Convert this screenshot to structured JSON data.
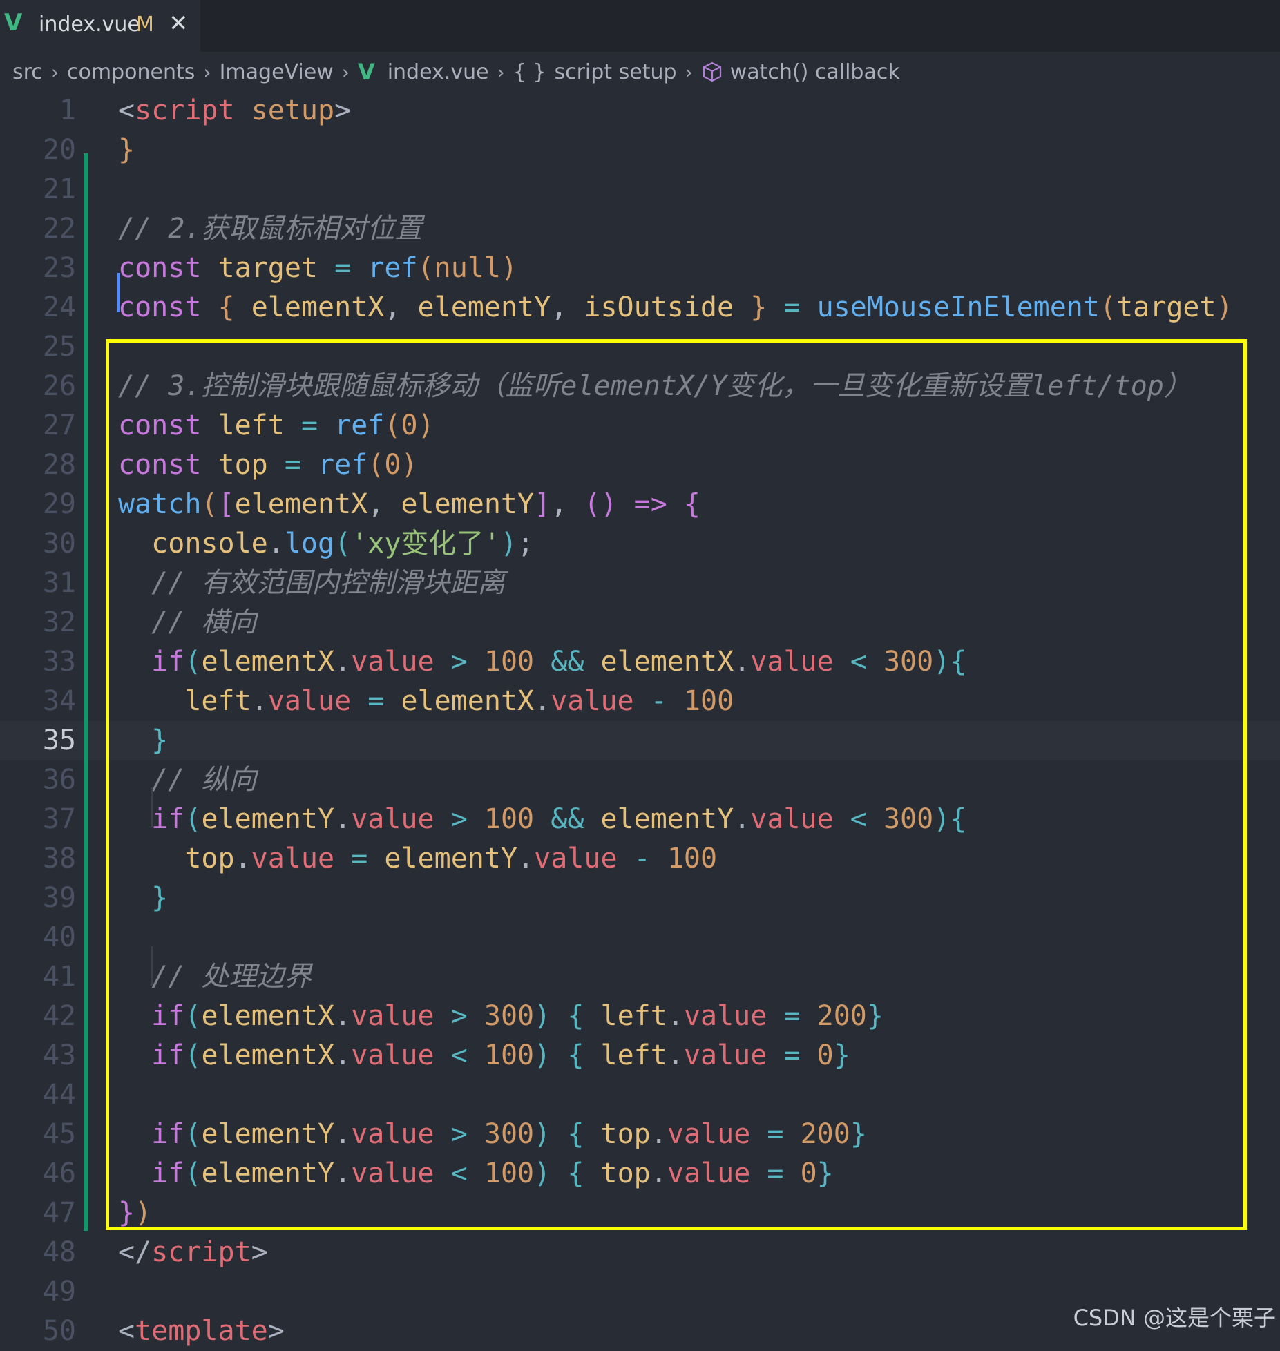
{
  "tab": {
    "filename": "index.vue",
    "status": "M",
    "close_glyph": "✕",
    "vue_icon": "V"
  },
  "breadcrumb": {
    "items": [
      "src",
      "components",
      "ImageView",
      "index.vue",
      "script setup",
      "watch() callback"
    ],
    "separator": "›",
    "braces_glyph": "{ }"
  },
  "editor": {
    "current_line": "35",
    "lines": [
      {
        "n": "1",
        "tokens": [
          [
            "tagp",
            "<"
          ],
          [
            "tag",
            "script"
          ],
          [
            "punc",
            " "
          ],
          [
            "attr",
            "setup"
          ],
          [
            "tagp",
            ">"
          ]
        ]
      },
      {
        "n": "20",
        "tokens": [
          [
            "b1",
            "}"
          ]
        ]
      },
      {
        "n": "21",
        "tokens": []
      },
      {
        "n": "22",
        "tokens": [
          [
            "com",
            "// 2.获取鼠标相对位置"
          ]
        ]
      },
      {
        "n": "23",
        "tokens": [
          [
            "kw",
            "const"
          ],
          [
            "punc",
            " "
          ],
          [
            "var",
            "target"
          ],
          [
            "punc",
            " "
          ],
          [
            "op",
            "="
          ],
          [
            "punc",
            " "
          ],
          [
            "fn",
            "ref"
          ],
          [
            "b1",
            "("
          ],
          [
            "num",
            "null"
          ],
          [
            "b1",
            ")"
          ]
        ]
      },
      {
        "n": "24",
        "tokens": [
          [
            "kw",
            "const"
          ],
          [
            "punc",
            " "
          ],
          [
            "b1",
            "{"
          ],
          [
            "punc",
            " "
          ],
          [
            "var",
            "elementX"
          ],
          [
            "punc",
            ", "
          ],
          [
            "var",
            "elementY"
          ],
          [
            "punc",
            ", "
          ],
          [
            "var",
            "isOutside"
          ],
          [
            "punc",
            " "
          ],
          [
            "b1",
            "}"
          ],
          [
            "punc",
            " "
          ],
          [
            "op",
            "="
          ],
          [
            "punc",
            " "
          ],
          [
            "fn",
            "useMouseInElement"
          ],
          [
            "b1",
            "("
          ],
          [
            "var",
            "target"
          ],
          [
            "b1",
            ")"
          ]
        ]
      },
      {
        "n": "25",
        "tokens": []
      },
      {
        "n": "26",
        "tokens": [
          [
            "com",
            "// 3.控制滑块跟随鼠标移动（监听elementX/Y变化，一旦变化重新设置left/top）"
          ]
        ]
      },
      {
        "n": "27",
        "tokens": [
          [
            "kw",
            "const"
          ],
          [
            "punc",
            " "
          ],
          [
            "var",
            "left"
          ],
          [
            "punc",
            " "
          ],
          [
            "op",
            "="
          ],
          [
            "punc",
            " "
          ],
          [
            "fn",
            "ref"
          ],
          [
            "b1",
            "("
          ],
          [
            "num",
            "0"
          ],
          [
            "b1",
            ")"
          ]
        ]
      },
      {
        "n": "28",
        "tokens": [
          [
            "kw",
            "const"
          ],
          [
            "punc",
            " "
          ],
          [
            "var",
            "top"
          ],
          [
            "punc",
            " "
          ],
          [
            "op",
            "="
          ],
          [
            "punc",
            " "
          ],
          [
            "fn",
            "ref"
          ],
          [
            "b1",
            "("
          ],
          [
            "num",
            "0"
          ],
          [
            "b1",
            ")"
          ]
        ]
      },
      {
        "n": "29",
        "tokens": [
          [
            "fn",
            "watch"
          ],
          [
            "b1",
            "("
          ],
          [
            "b2",
            "["
          ],
          [
            "var",
            "elementX"
          ],
          [
            "punc",
            ", "
          ],
          [
            "var",
            "elementY"
          ],
          [
            "b2",
            "]"
          ],
          [
            "punc",
            ", "
          ],
          [
            "b2",
            "()"
          ],
          [
            "punc",
            " "
          ],
          [
            "kw",
            "=>"
          ],
          [
            "punc",
            " "
          ],
          [
            "b2",
            "{"
          ]
        ]
      },
      {
        "n": "30",
        "tokens": [
          [
            "punc",
            "  "
          ],
          [
            "var",
            "console"
          ],
          [
            "punc",
            "."
          ],
          [
            "fn",
            "log"
          ],
          [
            "b3",
            "("
          ],
          [
            "str",
            "'xy变化了'"
          ],
          [
            "b3",
            ")"
          ],
          [
            "punc",
            ";"
          ]
        ]
      },
      {
        "n": "31",
        "tokens": [
          [
            "punc",
            "  "
          ],
          [
            "com",
            "// 有效范围内控制滑块距离"
          ]
        ]
      },
      {
        "n": "32",
        "tokens": [
          [
            "punc",
            "  "
          ],
          [
            "com",
            "// 横向"
          ]
        ]
      },
      {
        "n": "33",
        "tokens": [
          [
            "punc",
            "  "
          ],
          [
            "kw",
            "if"
          ],
          [
            "b3",
            "("
          ],
          [
            "var",
            "elementX"
          ],
          [
            "punc",
            "."
          ],
          [
            "prop",
            "value"
          ],
          [
            "punc",
            " "
          ],
          [
            "op",
            ">"
          ],
          [
            "punc",
            " "
          ],
          [
            "num",
            "100"
          ],
          [
            "punc",
            " "
          ],
          [
            "op",
            "&&"
          ],
          [
            "punc",
            " "
          ],
          [
            "var",
            "elementX"
          ],
          [
            "punc",
            "."
          ],
          [
            "prop",
            "value"
          ],
          [
            "punc",
            " "
          ],
          [
            "op",
            "<"
          ],
          [
            "punc",
            " "
          ],
          [
            "num",
            "300"
          ],
          [
            "b3",
            ")"
          ],
          [
            "b3",
            "{"
          ]
        ]
      },
      {
        "n": "34",
        "tokens": [
          [
            "punc",
            "    "
          ],
          [
            "var",
            "left"
          ],
          [
            "punc",
            "."
          ],
          [
            "prop",
            "value"
          ],
          [
            "punc",
            " "
          ],
          [
            "op",
            "="
          ],
          [
            "punc",
            " "
          ],
          [
            "var",
            "elementX"
          ],
          [
            "punc",
            "."
          ],
          [
            "prop",
            "value"
          ],
          [
            "punc",
            " "
          ],
          [
            "op",
            "-"
          ],
          [
            "punc",
            " "
          ],
          [
            "num",
            "100"
          ]
        ]
      },
      {
        "n": "35",
        "tokens": [
          [
            "punc",
            "  "
          ],
          [
            "b3",
            "}"
          ]
        ]
      },
      {
        "n": "36",
        "tokens": [
          [
            "punc",
            "  "
          ],
          [
            "com",
            "// 纵向"
          ]
        ]
      },
      {
        "n": "37",
        "tokens": [
          [
            "punc",
            "  "
          ],
          [
            "kw",
            "if"
          ],
          [
            "b3",
            "("
          ],
          [
            "var",
            "elementY"
          ],
          [
            "punc",
            "."
          ],
          [
            "prop",
            "value"
          ],
          [
            "punc",
            " "
          ],
          [
            "op",
            ">"
          ],
          [
            "punc",
            " "
          ],
          [
            "num",
            "100"
          ],
          [
            "punc",
            " "
          ],
          [
            "op",
            "&&"
          ],
          [
            "punc",
            " "
          ],
          [
            "var",
            "elementY"
          ],
          [
            "punc",
            "."
          ],
          [
            "prop",
            "value"
          ],
          [
            "punc",
            " "
          ],
          [
            "op",
            "<"
          ],
          [
            "punc",
            " "
          ],
          [
            "num",
            "300"
          ],
          [
            "b3",
            ")"
          ],
          [
            "b3",
            "{"
          ]
        ]
      },
      {
        "n": "38",
        "tokens": [
          [
            "punc",
            "    "
          ],
          [
            "var",
            "top"
          ],
          [
            "punc",
            "."
          ],
          [
            "prop",
            "value"
          ],
          [
            "punc",
            " "
          ],
          [
            "op",
            "="
          ],
          [
            "punc",
            " "
          ],
          [
            "var",
            "elementY"
          ],
          [
            "punc",
            "."
          ],
          [
            "prop",
            "value"
          ],
          [
            "punc",
            " "
          ],
          [
            "op",
            "-"
          ],
          [
            "punc",
            " "
          ],
          [
            "num",
            "100"
          ]
        ]
      },
      {
        "n": "39",
        "tokens": [
          [
            "punc",
            "  "
          ],
          [
            "b3",
            "}"
          ]
        ]
      },
      {
        "n": "40",
        "tokens": []
      },
      {
        "n": "41",
        "tokens": [
          [
            "punc",
            "  "
          ],
          [
            "com",
            "// 处理边界"
          ]
        ]
      },
      {
        "n": "42",
        "tokens": [
          [
            "punc",
            "  "
          ],
          [
            "kw",
            "if"
          ],
          [
            "b3",
            "("
          ],
          [
            "var",
            "elementX"
          ],
          [
            "punc",
            "."
          ],
          [
            "prop",
            "value"
          ],
          [
            "punc",
            " "
          ],
          [
            "op",
            ">"
          ],
          [
            "punc",
            " "
          ],
          [
            "num",
            "300"
          ],
          [
            "b3",
            ")"
          ],
          [
            "punc",
            " "
          ],
          [
            "b3",
            "{"
          ],
          [
            "punc",
            " "
          ],
          [
            "var",
            "left"
          ],
          [
            "punc",
            "."
          ],
          [
            "prop",
            "value"
          ],
          [
            "punc",
            " "
          ],
          [
            "op",
            "="
          ],
          [
            "punc",
            " "
          ],
          [
            "num",
            "200"
          ],
          [
            "b3",
            "}"
          ]
        ]
      },
      {
        "n": "43",
        "tokens": [
          [
            "punc",
            "  "
          ],
          [
            "kw",
            "if"
          ],
          [
            "b3",
            "("
          ],
          [
            "var",
            "elementX"
          ],
          [
            "punc",
            "."
          ],
          [
            "prop",
            "value"
          ],
          [
            "punc",
            " "
          ],
          [
            "op",
            "<"
          ],
          [
            "punc",
            " "
          ],
          [
            "num",
            "100"
          ],
          [
            "b3",
            ")"
          ],
          [
            "punc",
            " "
          ],
          [
            "b3",
            "{"
          ],
          [
            "punc",
            " "
          ],
          [
            "var",
            "left"
          ],
          [
            "punc",
            "."
          ],
          [
            "prop",
            "value"
          ],
          [
            "punc",
            " "
          ],
          [
            "op",
            "="
          ],
          [
            "punc",
            " "
          ],
          [
            "num",
            "0"
          ],
          [
            "b3",
            "}"
          ]
        ]
      },
      {
        "n": "44",
        "tokens": []
      },
      {
        "n": "45",
        "tokens": [
          [
            "punc",
            "  "
          ],
          [
            "kw",
            "if"
          ],
          [
            "b3",
            "("
          ],
          [
            "var",
            "elementY"
          ],
          [
            "punc",
            "."
          ],
          [
            "prop",
            "value"
          ],
          [
            "punc",
            " "
          ],
          [
            "op",
            ">"
          ],
          [
            "punc",
            " "
          ],
          [
            "num",
            "300"
          ],
          [
            "b3",
            ")"
          ],
          [
            "punc",
            " "
          ],
          [
            "b3",
            "{"
          ],
          [
            "punc",
            " "
          ],
          [
            "var",
            "top"
          ],
          [
            "punc",
            "."
          ],
          [
            "prop",
            "value"
          ],
          [
            "punc",
            " "
          ],
          [
            "op",
            "="
          ],
          [
            "punc",
            " "
          ],
          [
            "num",
            "200"
          ],
          [
            "b3",
            "}"
          ]
        ]
      },
      {
        "n": "46",
        "tokens": [
          [
            "punc",
            "  "
          ],
          [
            "kw",
            "if"
          ],
          [
            "b3",
            "("
          ],
          [
            "var",
            "elementY"
          ],
          [
            "punc",
            "."
          ],
          [
            "prop",
            "value"
          ],
          [
            "punc",
            " "
          ],
          [
            "op",
            "<"
          ],
          [
            "punc",
            " "
          ],
          [
            "num",
            "100"
          ],
          [
            "b3",
            ")"
          ],
          [
            "punc",
            " "
          ],
          [
            "b3",
            "{"
          ],
          [
            "punc",
            " "
          ],
          [
            "var",
            "top"
          ],
          [
            "punc",
            "."
          ],
          [
            "prop",
            "value"
          ],
          [
            "punc",
            " "
          ],
          [
            "op",
            "="
          ],
          [
            "punc",
            " "
          ],
          [
            "num",
            "0"
          ],
          [
            "b3",
            "}"
          ]
        ]
      },
      {
        "n": "47",
        "tokens": [
          [
            "b2",
            "}"
          ],
          [
            "b1",
            ")"
          ]
        ]
      },
      {
        "n": "48",
        "tokens": [
          [
            "tagp",
            "</"
          ],
          [
            "tag",
            "script"
          ],
          [
            "tagp",
            ">"
          ]
        ]
      },
      {
        "n": "49",
        "tokens": []
      },
      {
        "n": "50",
        "tokens": [
          [
            "tagp",
            "<"
          ],
          [
            "tag",
            "template"
          ],
          [
            "tagp",
            ">"
          ]
        ]
      }
    ]
  },
  "watermark": "CSDN @这是个栗子",
  "colors": {
    "editor_bg": "#282c34",
    "tabbar_bg": "#21252b",
    "highlight_box": "#ffff00",
    "git_added": "#109868",
    "vue_green": "#41b883"
  }
}
